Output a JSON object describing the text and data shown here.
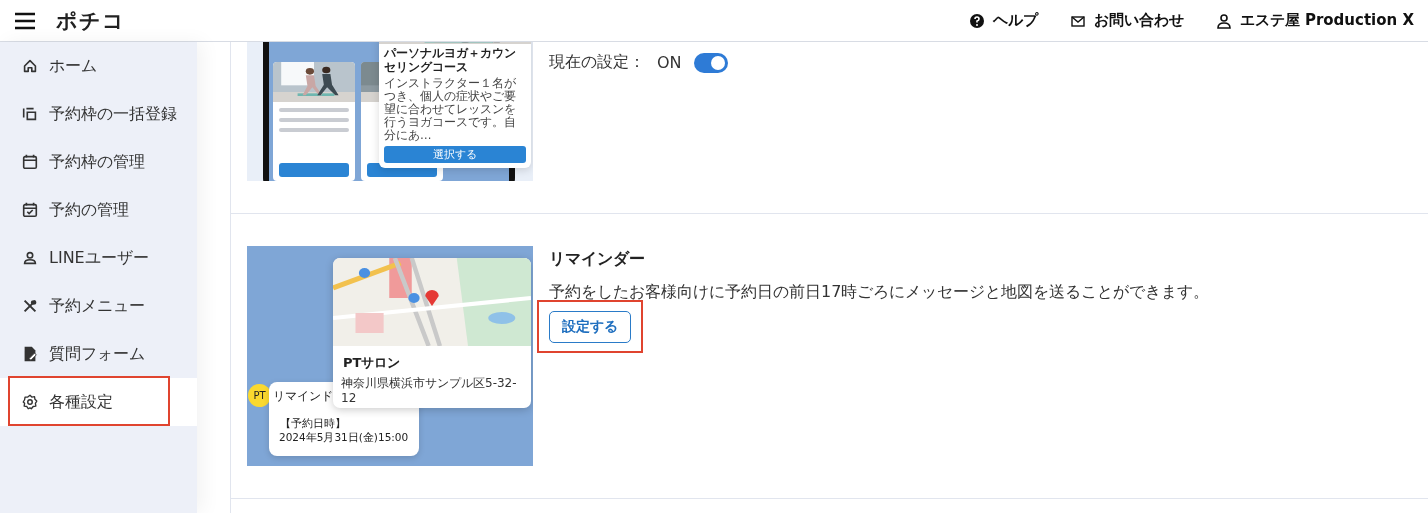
{
  "header": {
    "logo": "ポチコ",
    "links": [
      {
        "label": "ヘルプ"
      },
      {
        "label": "お問い合わせ"
      },
      {
        "label": "エステ屋 Production X"
      }
    ]
  },
  "sidebar": {
    "items": [
      {
        "label": "ホーム",
        "selected": false,
        "highlighted": false
      },
      {
        "label": "予約枠の一括登録",
        "selected": false,
        "highlighted": false
      },
      {
        "label": "予約枠の管理",
        "selected": false,
        "highlighted": false
      },
      {
        "label": "予約の管理",
        "selected": false,
        "highlighted": false
      },
      {
        "label": "LINEユーザー",
        "selected": false,
        "highlighted": false
      },
      {
        "label": "予約メニュー",
        "selected": false,
        "highlighted": false
      },
      {
        "label": "質問フォーム",
        "selected": false,
        "highlighted": false
      },
      {
        "label": "各種設定",
        "selected": true,
        "highlighted": true
      }
    ]
  },
  "settings": [
    {
      "kind": "toggle",
      "preview": {
        "kind": "course",
        "card_title": "パーソナルヨガ＋カウンセリングコース",
        "card_text": "インストラクター１名がつき、個人の症状やご要望に合わせてレッスンを行うヨガコースです。自分にあ…",
        "card_button": "選択する"
      },
      "current_label": "現在の設定：",
      "current_value": "ON",
      "on": true
    },
    {
      "kind": "action",
      "preview": {
        "kind": "reminder",
        "avatar": "PT",
        "bubble_title": "リマインド",
        "bubble_label": "【予約日時】",
        "bubble_date": "2024年5月31日(金)15:00",
        "place_name": "PTサロン",
        "place_address": "神奈川県横浜市サンプル区5-32-12"
      },
      "title": "リマインダー",
      "description": "予約をしたお客様向けに予約日の前日17時ごろにメッセージと地図を送ることができます。",
      "button": {
        "label": "設定する",
        "highlighted": true
      }
    }
  ]
}
